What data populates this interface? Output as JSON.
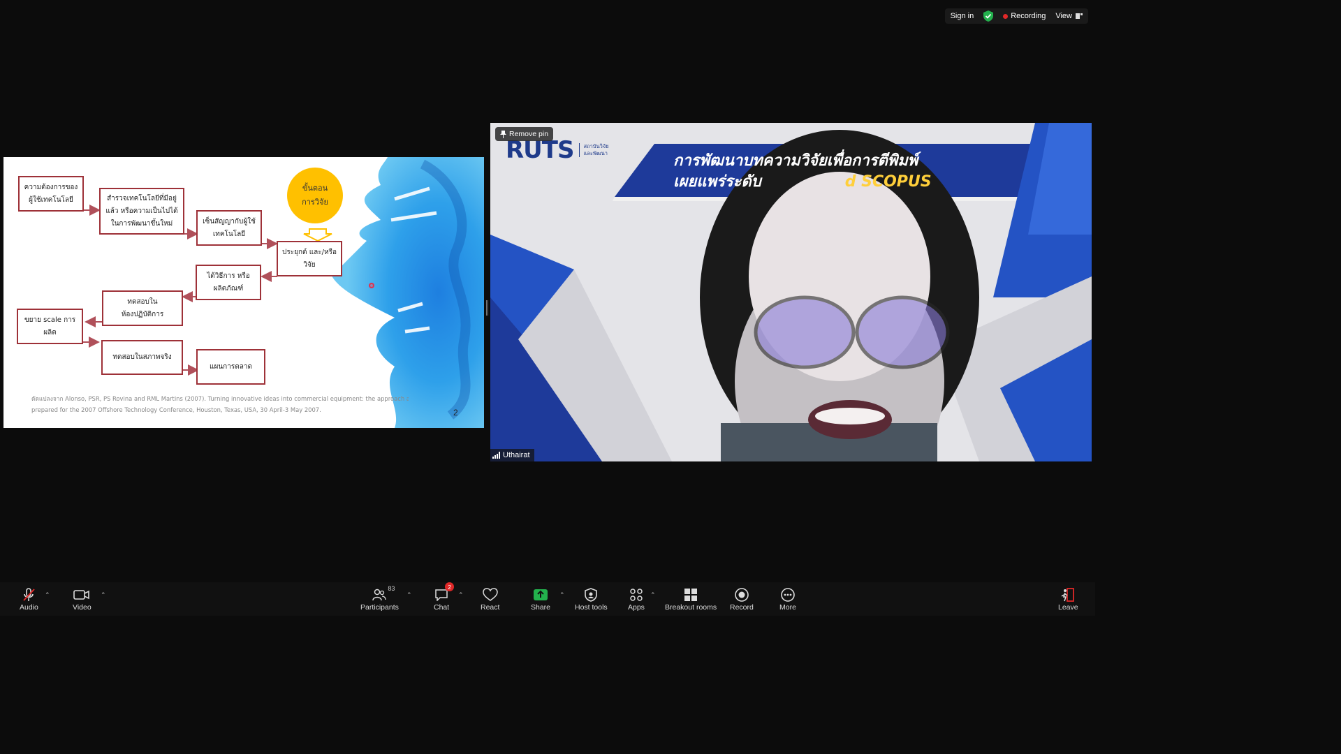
{
  "topbar": {
    "sign_in": "Sign in",
    "recording": "Recording",
    "view": "View"
  },
  "slide": {
    "boxes": [
      "ความต้องการของ\nผู้ใช้เทคโนโลยี",
      "สำรวจเทคโนโลยีที่มีอยู่\nแล้ว หรือความเป็นไปได้\nในการพัฒนาขึ้นใหม่",
      "เซ็นสัญญากับผู้ใช้\nเทคโนโลยี",
      "ประยุกต์ และ/หรือ\nวิจัย",
      "ได้วิธีการ หรือ\nผลิตภัณฑ์",
      "ทดสอบใน\nห้องปฏิบัติการ",
      "ขยาย scale การ\nผลิต",
      "ทดสอบในสภาพจริง",
      "แผนการตลาด"
    ],
    "circle": "ขั้นตอน\nการวิจัย",
    "citation_line1": "ดัดแปลงจาก Alonso, PSR, PS Rovina and RML Martins (2007). Turning innovative ideas into commercial equipment: the approach a",
    "citation_line2": "prepared for the 2007 Offshore Technology Conference, Houston, Texas, USA, 30 April-3 May 2007.",
    "page_number": "2"
  },
  "video": {
    "remove_pin": "Remove pin",
    "logo": "RUTS",
    "institute": "สถาบันวิจัย\nและพัฒนา",
    "banner_line1": "การพัฒนาบทความวิจัยเพื่อการตีพิมพ์",
    "banner_line2_a": "เผยแพร่ระดับ",
    "banner_line2_b": "d SCOPUS",
    "participant_name": "Uthairat"
  },
  "toolbar": {
    "audio": "Audio",
    "video": "Video",
    "participants": "Participants",
    "participants_count": "83",
    "chat": "Chat",
    "chat_badge": "2",
    "react": "React",
    "share": "Share",
    "host_tools": "Host tools",
    "apps": "Apps",
    "breakout_rooms": "Breakout rooms",
    "record": "Record",
    "more": "More",
    "leave": "Leave"
  }
}
